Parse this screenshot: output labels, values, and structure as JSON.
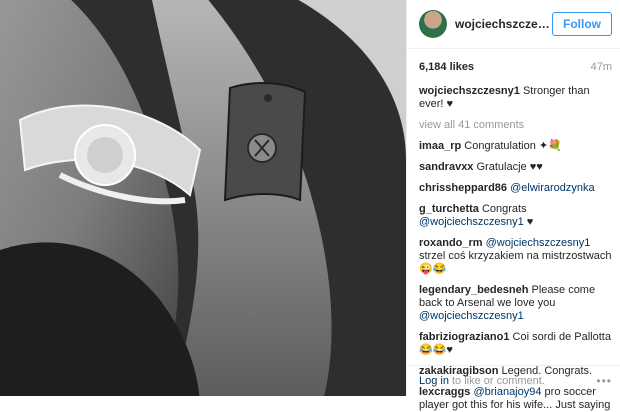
{
  "post": {
    "username": "wojciechszczesny1",
    "follow_label": "Follow",
    "likes": "6,184 likes",
    "time": "47m",
    "caption_user": "wojciechszczesny1",
    "caption_text": "Stronger than ever!",
    "caption_heart": "♥",
    "view_all": "view all 41 comments"
  },
  "comments": [
    {
      "user": "imaa_rp",
      "text": "Congratulation ✦💐"
    },
    {
      "user": "sandravxx",
      "text": "Gratulacje ♥♥"
    },
    {
      "user": "chrissheppard86",
      "mention": "@elwirarodzynka"
    },
    {
      "user": "g_turchetta",
      "text": "Congrats",
      "mention": "@wojciechszczesny1",
      "after": " ♥"
    },
    {
      "user": "roxando_rm",
      "mention": "@wojciechszczesny1",
      "text": "strzel coś krzyzakiem na mistrzostwach 😜😂"
    },
    {
      "user": "legendary_bedesneh",
      "text": "Please come back to Arsenal we love you",
      "mention": "@wojciechszczesny1"
    },
    {
      "user": "fabriziograziano1",
      "text": "Coi sordi de Pallotta 😂😂♥"
    },
    {
      "user": "zakakiragibson",
      "text": "Legend. Congrats."
    },
    {
      "user": "lexcraggs",
      "mention": "@brianajoy94",
      "text": "pro soccer player got this for his wife... Just saying"
    }
  ],
  "footer": {
    "login": "Log in",
    "login_tail": "to like or comment.",
    "more_icon": "more-options-icon"
  }
}
